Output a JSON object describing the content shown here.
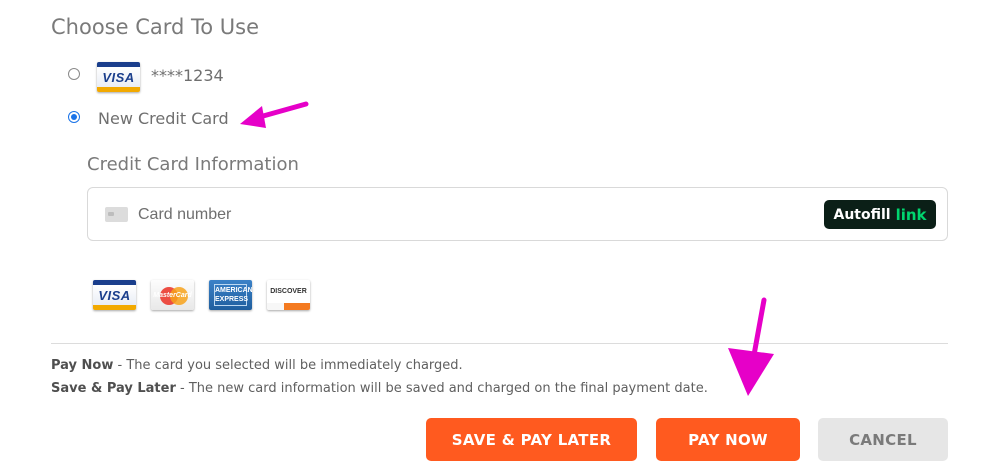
{
  "section_title": "Choose Card To Use",
  "saved_card": {
    "brand": "VISA",
    "masked_number": "****1234",
    "selected": false
  },
  "new_card": {
    "label": "New Credit Card",
    "selected": true
  },
  "credit_card_info": {
    "title": "Credit Card Information",
    "card_number_placeholder": "Card number",
    "autofill": {
      "text": "Autofill",
      "link_text": "link"
    }
  },
  "accepted_cards": [
    {
      "name": "VISA",
      "icon": "visa-logo-icon"
    },
    {
      "name": "MasterCard",
      "icon": "mastercard-logo-icon"
    },
    {
      "name": "AMERICAN EXPRESS",
      "icon": "amex-logo-icon"
    },
    {
      "name": "DISCOVER",
      "icon": "discover-logo-icon"
    }
  ],
  "help": {
    "pay_now_term": "Pay Now",
    "pay_now_desc": " - The card you selected will be immediately charged.",
    "save_later_term": "Save & Pay Later",
    "save_later_desc": " - The new card information will be saved and charged on the final payment date."
  },
  "buttons": {
    "save_pay_later": "SAVE & PAY LATER",
    "pay_now": "PAY NOW",
    "cancel": "CANCEL"
  },
  "colors": {
    "accent_orange": "#ff5a1f",
    "annotation_magenta": "#e600c8",
    "radio_blue": "#1a73e8",
    "link_green": "#00d66f"
  }
}
